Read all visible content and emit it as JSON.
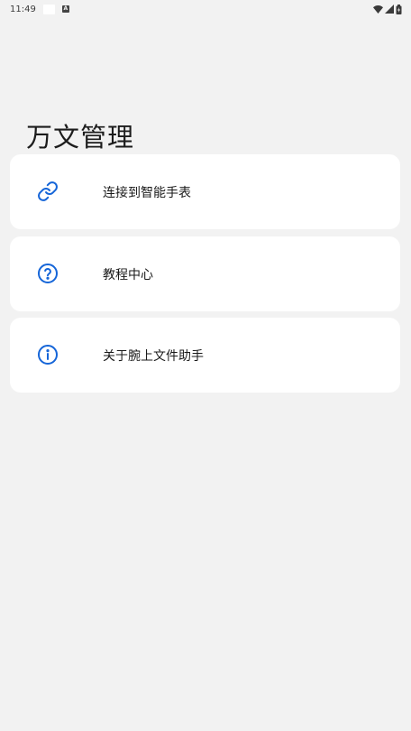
{
  "status_bar": {
    "time": "11:49",
    "notification_icon": "a-badge-icon",
    "wifi_icon": "wifi-icon",
    "signal_icon": "signal-icon",
    "battery_icon": "battery-icon"
  },
  "page": {
    "title": "万文管理"
  },
  "menu": {
    "items": [
      {
        "label": "连接到智能手表",
        "icon": "link-icon"
      },
      {
        "label": "教程中心",
        "icon": "help-circle-icon"
      },
      {
        "label": "关于腕上文件助手",
        "icon": "info-circle-icon"
      }
    ]
  },
  "colors": {
    "accent": "#1565d8",
    "background": "#f2f2f2",
    "card": "#ffffff"
  }
}
